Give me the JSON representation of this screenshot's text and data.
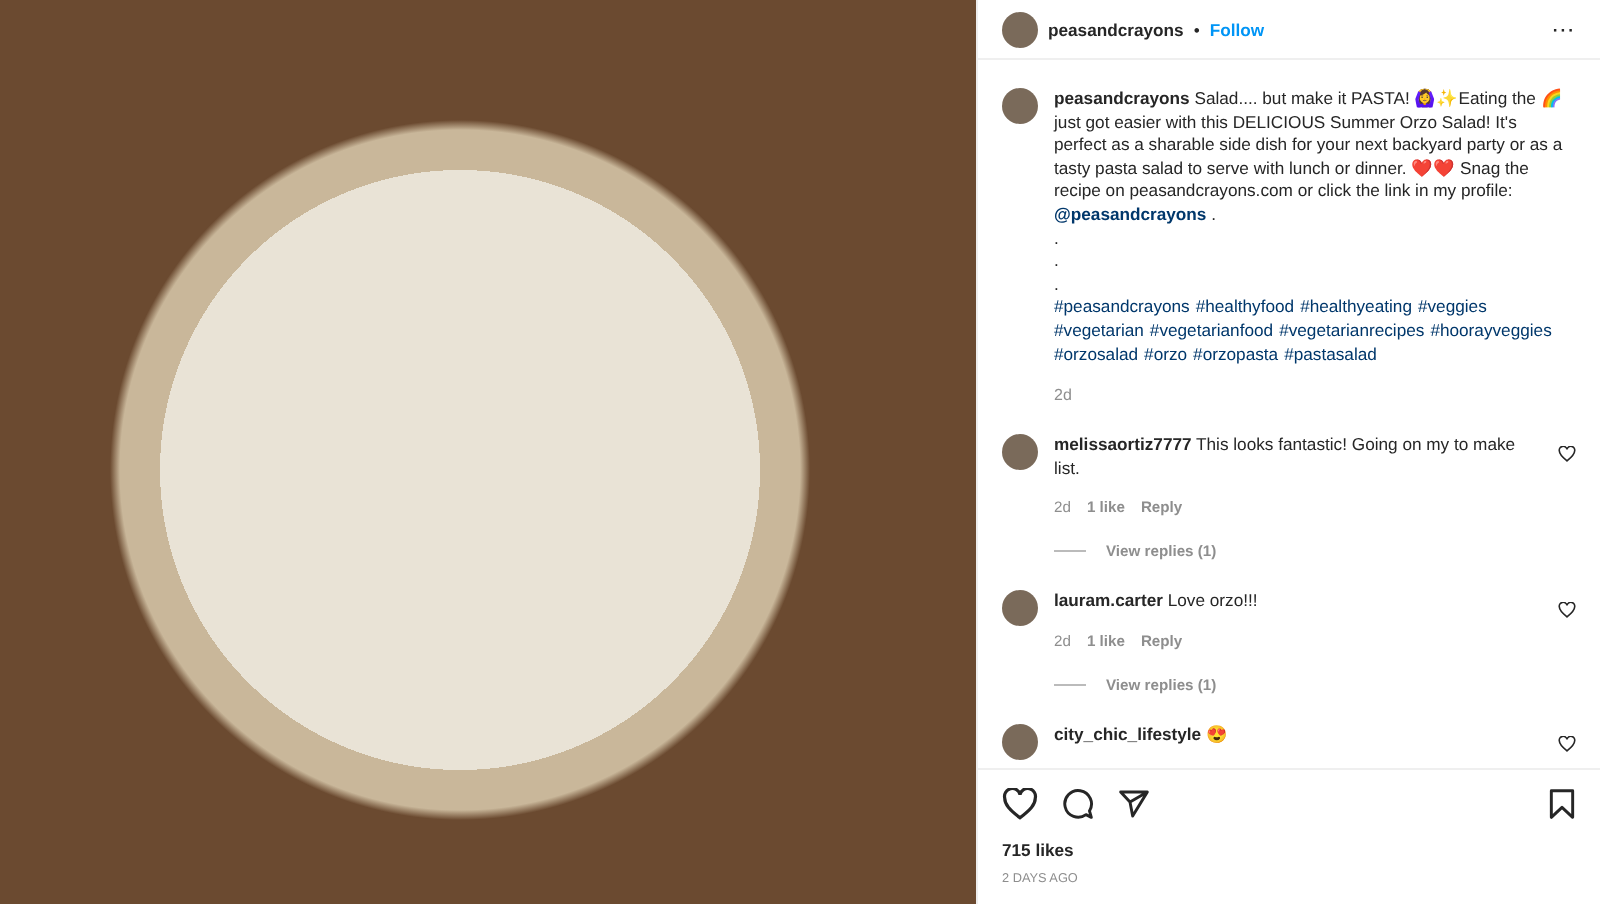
{
  "post": {
    "username": "peasandcrayons",
    "follow": "Follow",
    "separator": "•",
    "more": "···"
  },
  "caption": {
    "username": "peasandcrayons",
    "text": "Salad.... but make it PASTA! 🙆‍♀️✨Eating the 🌈 just got easier with this DELICIOUS Summer Orzo Salad! It's perfect as a sharable side dish for your next backyard party or as a tasty pasta salad to serve with lunch or dinner. ❤️❤️ Snag the recipe on peasandcrayons.com or click the link in my profile:",
    "mention": "@peasandcrayons",
    "mention_suffix": ".",
    "dots": [
      ".",
      ".",
      "."
    ],
    "hashtags": [
      "#peasandcrayons",
      "#healthyfood",
      "#healthyeating",
      "#veggies",
      "#vegetarian",
      "#vegetarianfood",
      "#vegetarianrecipes",
      "#hoorayveggies",
      "#orzosalad",
      "#orzo",
      "#orzopasta",
      "#pastasalad"
    ],
    "time": "2d"
  },
  "comments": [
    {
      "username": "melissaortiz7777",
      "text": "This looks fantastic! Going on my to make list.",
      "time": "2d",
      "likes": "1 like",
      "reply": "Reply",
      "view_replies": "View replies (1)"
    },
    {
      "username": "lauram.carter",
      "text": "Love orzo!!!",
      "time": "2d",
      "likes": "1 like",
      "reply": "Reply",
      "view_replies": "View replies (1)"
    },
    {
      "username": "city_chic_lifestyle",
      "text": "😍"
    }
  ],
  "likes": "715 likes",
  "date": "2 DAYS AGO"
}
